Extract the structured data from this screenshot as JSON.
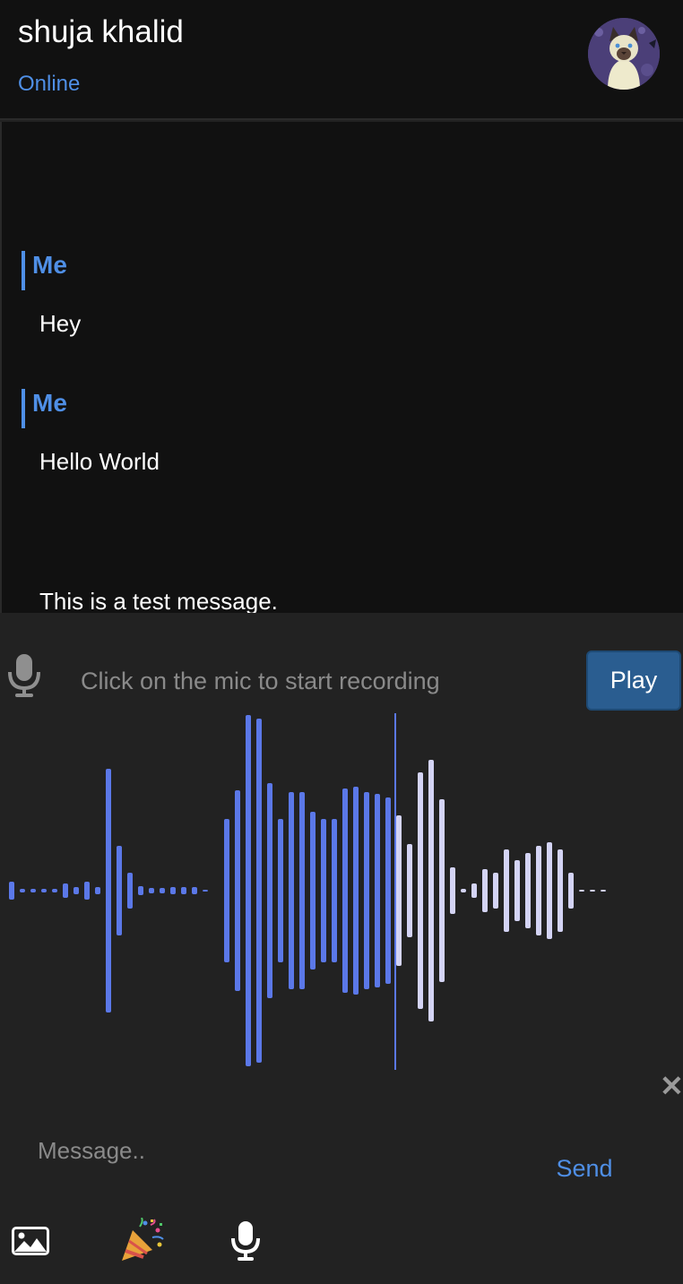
{
  "header": {
    "contact_name": "shuja khalid",
    "status": "Online"
  },
  "messages": [
    {
      "sender": "Me",
      "text": "Hey"
    },
    {
      "sender": "Me",
      "text": "Hello World"
    },
    {
      "sender": "",
      "text": "This is a test message."
    }
  ],
  "recorder": {
    "hint": "Click on the mic to start recording",
    "play_label": "Play",
    "progress_fraction": 0.55,
    "played_color": "#5b78e8",
    "unplayed_color": "#d4d4f5"
  },
  "composer": {
    "placeholder": "Message..",
    "send_label": "Send",
    "close_symbol": "✕"
  },
  "icons": {
    "image_button": "image-icon",
    "celebrate_button": "party-popper-icon",
    "voice_button": "microphone-icon"
  },
  "colors": {
    "accent": "#4f8fe6",
    "play_button": "#2a5d90",
    "header_bg": "#111111",
    "panel_bg": "#222222"
  }
}
